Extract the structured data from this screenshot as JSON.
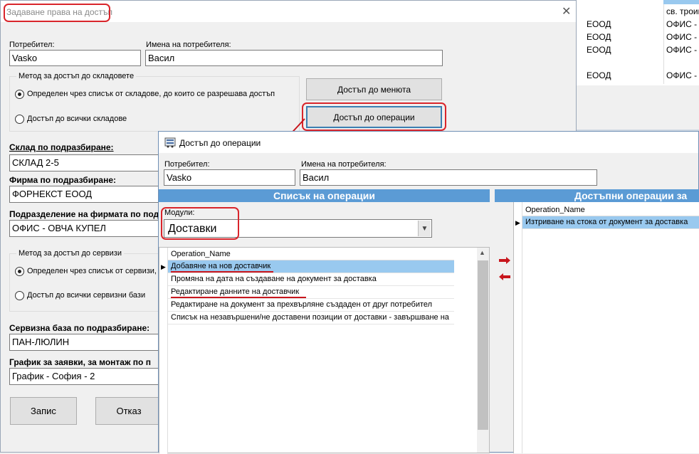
{
  "background_list": {
    "rows": [
      {
        "col1": "ЕООД",
        "col2": "св. троиц"
      },
      {
        "col1": "ЕООД",
        "col2": "ОФИС - ("
      },
      {
        "col1": "ЕООД",
        "col2": "ОФИС - ("
      },
      {
        "col1": "ЕООД",
        "col2": "ОФИС - ("
      },
      {
        "col1": "ЕООД",
        "col2": "ОФИС - ("
      }
    ]
  },
  "access_window": {
    "title": "Задаване права на достъп",
    "user_label": "Потребител:",
    "user_value": "Vasko",
    "name_label": "Имена на потребителя:",
    "name_value": "Васил",
    "warehouse_group_label": "Метод за достъп до складовете",
    "warehouse_radio_list": "Определен чрез списък от складове, до които се разрешава достъп",
    "warehouse_radio_all": "Достъп до всички складове",
    "menus_button": "Достъп до менюта",
    "operations_button": "Достъп до операции",
    "default_warehouse_label": "Склад по подразбиране:",
    "default_warehouse_value": "СКЛАД 2-5",
    "default_company_label": "Фирма по подразбиране:",
    "default_company_value": "ФОРНЕКСТ ЕООД",
    "default_division_label": "Подразделение на фирмата по под",
    "default_division_value": "ОФИС - ОВЧА КУПЕЛ",
    "service_group_label": "Метод за достъп до сервизи",
    "service_radio_list": "Определен чрез списък от сервизи,",
    "service_radio_all": "Достъп до всички сервизни бази",
    "default_service_label": "Сервизна база по подразбиране:",
    "default_service_value": "ПАН-ЛЮЛИН",
    "schedule_label": "График за заявки, за монтаж по п",
    "schedule_value": "График - София - 2",
    "save_button": "Запис",
    "cancel_button": "Отказ"
  },
  "operations_window": {
    "title": "Достъп до операции",
    "user_label": "Потребител:",
    "user_value": "Vasko",
    "name_label": "Имена на потребителя:",
    "name_value": "Васил",
    "left_header": "Списък на операции",
    "right_header": "Достъпни операции за",
    "modules_label": "Модули:",
    "modules_value": "Доставки",
    "column_header": "Operation_Name",
    "operations": [
      "Добавяне на нов доставчик",
      "Промяна на дата на създаване на документ за доставка",
      "Редактиране данните на доставчик",
      "Редактиране на документ за прехвърляне създаден от друг потребител",
      "Списък на незавършени/не доставени позиции от доставки - завършване на"
    ],
    "available_column_header": "Operation_Name",
    "available_operations": [
      "Изтриване на стока от документ за доставка"
    ]
  },
  "colors": {
    "header_blue": "#5b9bd5",
    "selection": "#99c9ef",
    "annotation_red": "#d9252b"
  }
}
